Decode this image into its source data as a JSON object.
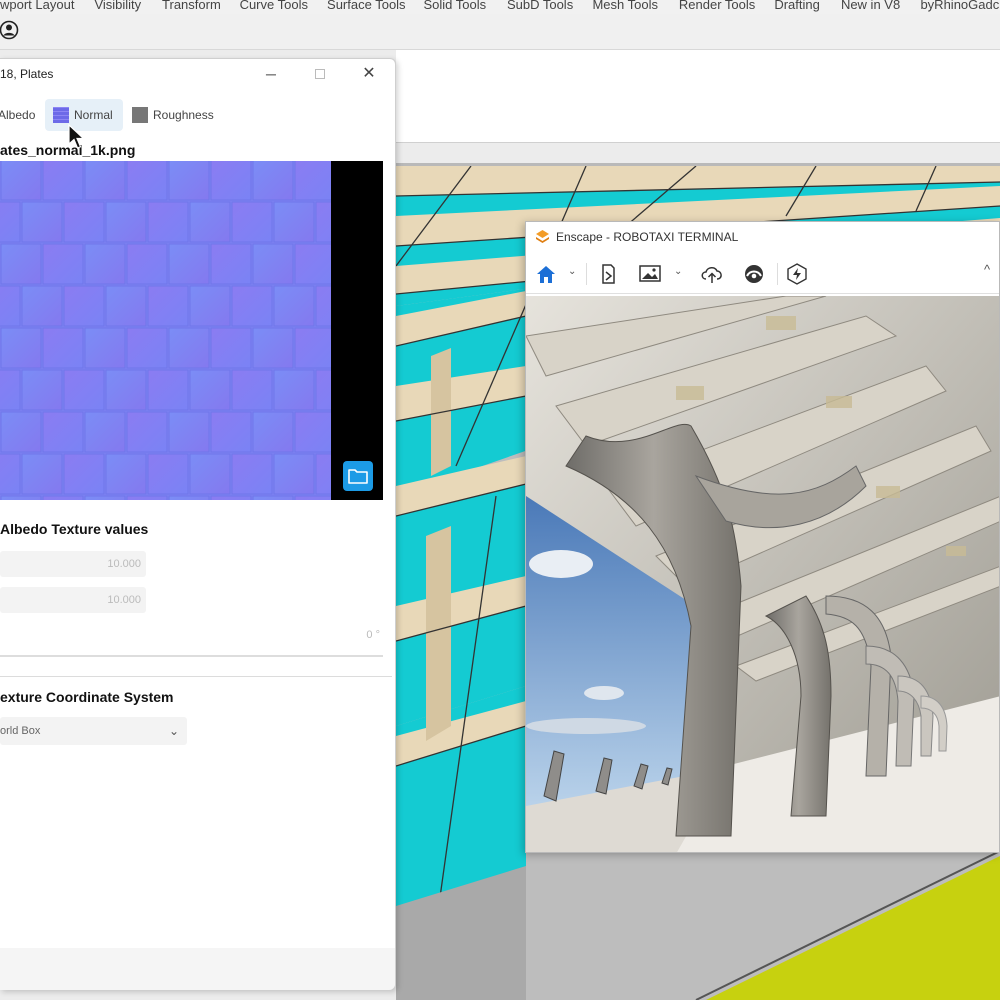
{
  "rhino": {
    "tabs": [
      "wport Layout",
      "Visibility",
      "Transform",
      "Curve Tools",
      "Surface Tools",
      "Solid Tools",
      "SubD Tools",
      "Mesh Tools",
      "Render Tools",
      "Drafting",
      "New in V8",
      "byRhinoGadc"
    ],
    "user_icon": "user-circle-icon"
  },
  "material_panel": {
    "title": "18, Plates",
    "window_controls": {
      "minimize": "─",
      "maximize": "□",
      "close": "✕"
    },
    "channel_tabs": {
      "albedo": "Albedo",
      "normal": "Normal",
      "roughness": "Roughness",
      "active": "normal"
    },
    "texture_filename": "ates_normal_1k.png",
    "folder_icon": "folder-icon",
    "albedo_values_title": "Albedo Texture values",
    "repeat_u": "10.000",
    "repeat_v": "10.000",
    "rotation": "0 °",
    "tcs_title": "exture Coordinate System",
    "tcs_value": "orld Box",
    "tcs_chevron": "⌄"
  },
  "enscape": {
    "title": "Enscape - ROBOTAXI TERMINAL",
    "toolbar_icons": [
      "home-icon",
      "chevron-down-icon",
      "export-icon",
      "screenshot-icon",
      "chevron-down-icon",
      "upload-icon",
      "view-icon",
      "lightning-icon",
      "chevron-up-icon"
    ],
    "chevron_down": "⌄",
    "chevron_up": "^"
  },
  "colors": {
    "accent_blue": "#1c9be6",
    "enscape_orange": "#f39c27",
    "viewport_cyan": "#14cbd2",
    "viewport_beige": "#e8d8b8",
    "viewport_yellow": "#c7d10f"
  }
}
